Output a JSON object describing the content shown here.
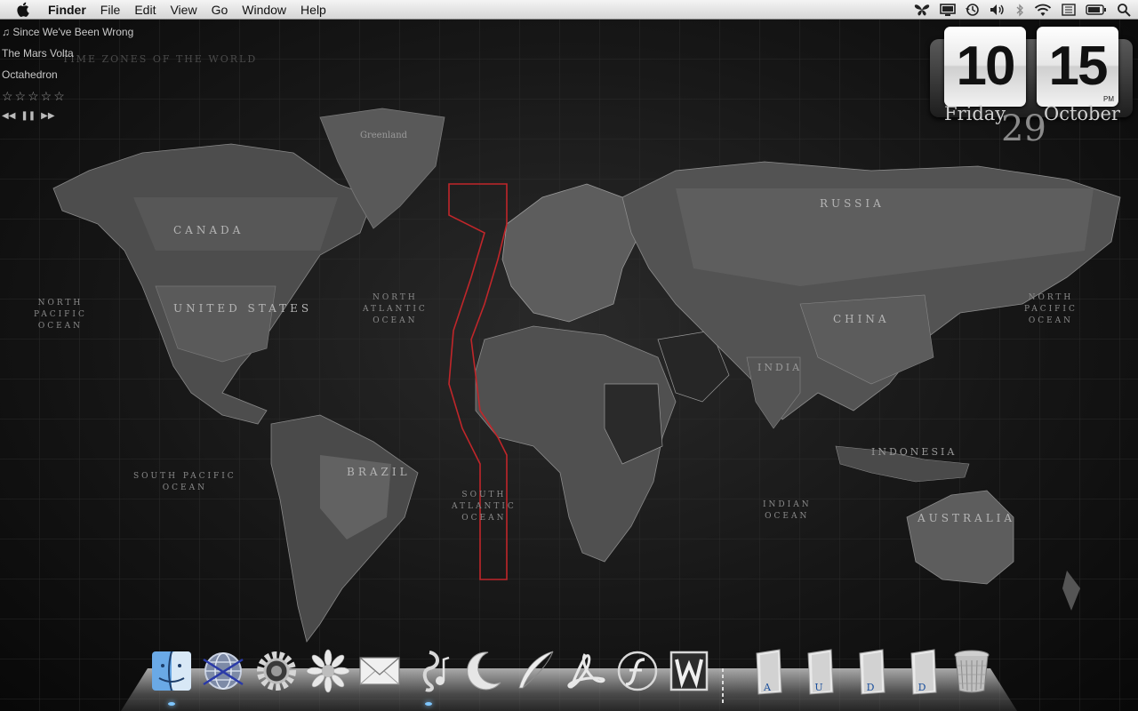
{
  "menubar": {
    "app_name": "Finder",
    "items": [
      "File",
      "Edit",
      "View",
      "Go",
      "Window",
      "Help"
    ],
    "status_icons": [
      "butterfly-icon",
      "display-icon",
      "time-machine-icon",
      "volume-icon",
      "bluetooth-icon",
      "wifi-icon",
      "input-menu-icon",
      "battery-icon",
      "spotlight-icon"
    ]
  },
  "now_playing": {
    "track": "Since We've Been Wrong",
    "artist": "The Mars Volta",
    "album": "Octahedron",
    "rating": "☆☆☆☆☆",
    "controls": [
      "◀◀",
      "❚❚",
      "▶▶"
    ]
  },
  "clock": {
    "hour": "10",
    "minute": "15",
    "ampm": "PM",
    "weekday": "Friday",
    "day": "29",
    "month": "October"
  },
  "map": {
    "title": "TIME ZONES OF THE WORLD",
    "labels": {
      "canada": "CANADA",
      "united_states": "UNITED STATES",
      "brazil": "BRAZIL",
      "russia": "RUSSIA",
      "china": "CHINA",
      "india": "INDIA",
      "indonesia": "INDONESIA",
      "australia": "AUSTRALIA",
      "greenland": "Greenland",
      "north_pacific_left": "NORTH\nPACIFIC\nOCEAN",
      "north_atlantic": "NORTH\nATLANTIC\nOCEAN",
      "south_pacific": "SOUTH PACIFIC\nOCEAN",
      "south_atlantic": "SOUTH\nATLANTIC\nOCEAN",
      "indian_ocean": "INDIAN\nOCEAN",
      "north_pacific_right": "NORTH\nPACIFIC\nOCEAN"
    }
  },
  "dock": {
    "apps": [
      "finder-icon",
      "network-icon",
      "system-preferences-icon",
      "daisy-icon",
      "mail-icon",
      "itunes-icon",
      "moon-icon",
      "quill-icon",
      "acrobat-icon",
      "flash-icon",
      "word-icon"
    ],
    "stacks": [
      "A",
      "U",
      "D",
      "D"
    ],
    "trash": "trash-icon"
  }
}
